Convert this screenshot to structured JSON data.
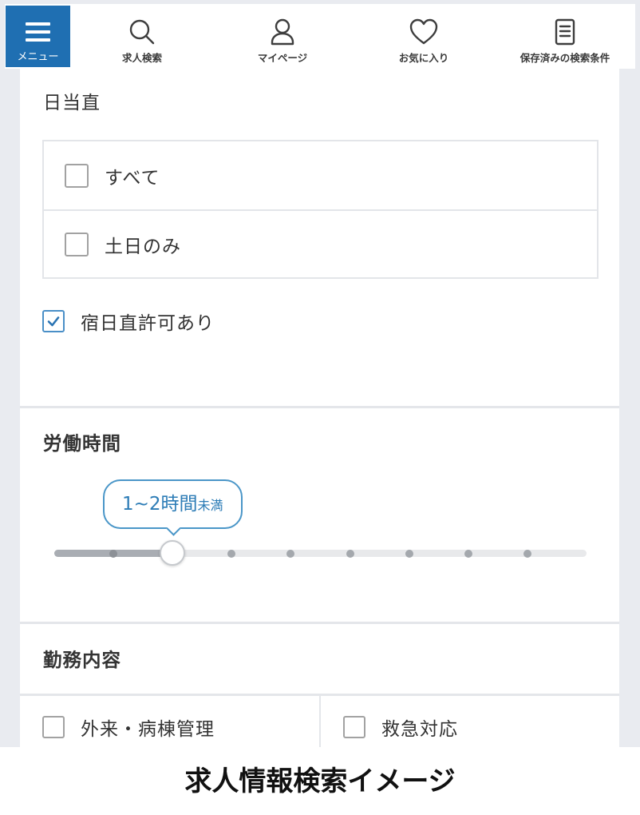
{
  "nav": {
    "menu_label": "メニュー",
    "items": [
      {
        "label": "求人検索",
        "icon": "search-icon"
      },
      {
        "label": "マイページ",
        "icon": "person-icon"
      },
      {
        "label": "お気に入り",
        "icon": "heart-icon"
      },
      {
        "label": "保存済みの検索条件",
        "icon": "document-icon"
      }
    ]
  },
  "duty": {
    "title": "日当直",
    "options": [
      {
        "label": "すべて",
        "checked": false
      },
      {
        "label": "土日のみ",
        "checked": false
      }
    ],
    "permit": {
      "label": "宿日直許可あり",
      "checked": true
    }
  },
  "hours": {
    "title": "労働時間",
    "slider": {
      "value": "1~2時間",
      "suffix": "未満",
      "step_index": 2,
      "step_count": 10
    }
  },
  "work": {
    "title": "勤務内容",
    "options": [
      {
        "label": "外来・病棟管理",
        "checked": false
      },
      {
        "label": "救急対応",
        "checked": false
      }
    ]
  },
  "caption": "求人情報検索イメージ",
  "colors": {
    "accent": "#1f6fb2",
    "tooltip": "#4a96c8",
    "text": "#333333"
  }
}
